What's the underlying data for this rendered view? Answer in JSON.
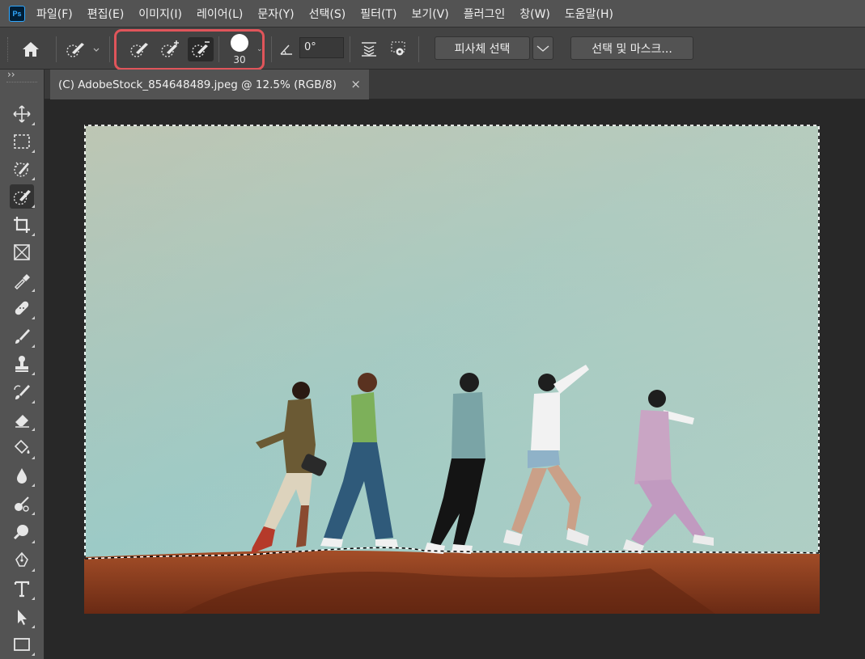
{
  "app": {
    "logo_text": "Ps"
  },
  "menu": [
    "파일(F)",
    "편집(E)",
    "이미지(I)",
    "레이어(L)",
    "문자(Y)",
    "선택(S)",
    "필터(T)",
    "보기(V)",
    "플러그인",
    "창(W)",
    "도움말(H)"
  ],
  "options": {
    "brush_size": "30",
    "angle": "0°",
    "select_subject_label": "피사체 선택",
    "select_and_mask_label": "선택 및 마스크..."
  },
  "document_tab": {
    "title": "(C) AdobeStock_854648489.jpeg @ 12.5% (RGB/8)",
    "close": "×"
  },
  "panel_collapse": "››",
  "tools": [
    "move-tool-icon",
    "marquee-tool-icon",
    "object-selection-tool-icon",
    "quick-selection-tool-icon",
    "crop-tool-icon",
    "frame-tool-icon",
    "eyedropper-tool-icon",
    "spot-healing-tool-icon",
    "brush-tool-icon",
    "clone-stamp-tool-icon",
    "history-brush-tool-icon",
    "eraser-tool-icon",
    "paint-bucket-tool-icon",
    "blur-tool-icon",
    "dodge-tool-icon",
    "zoom-tool-icon",
    "pen-tool-icon",
    "type-tool-icon",
    "path-selection-tool-icon",
    "rectangle-tool-icon"
  ],
  "colors": {
    "highlight": "#e0555a",
    "sky_top": "#b7c2b1",
    "sky_bottom": "#9fd4d2",
    "ground": "#8a3b1c"
  }
}
